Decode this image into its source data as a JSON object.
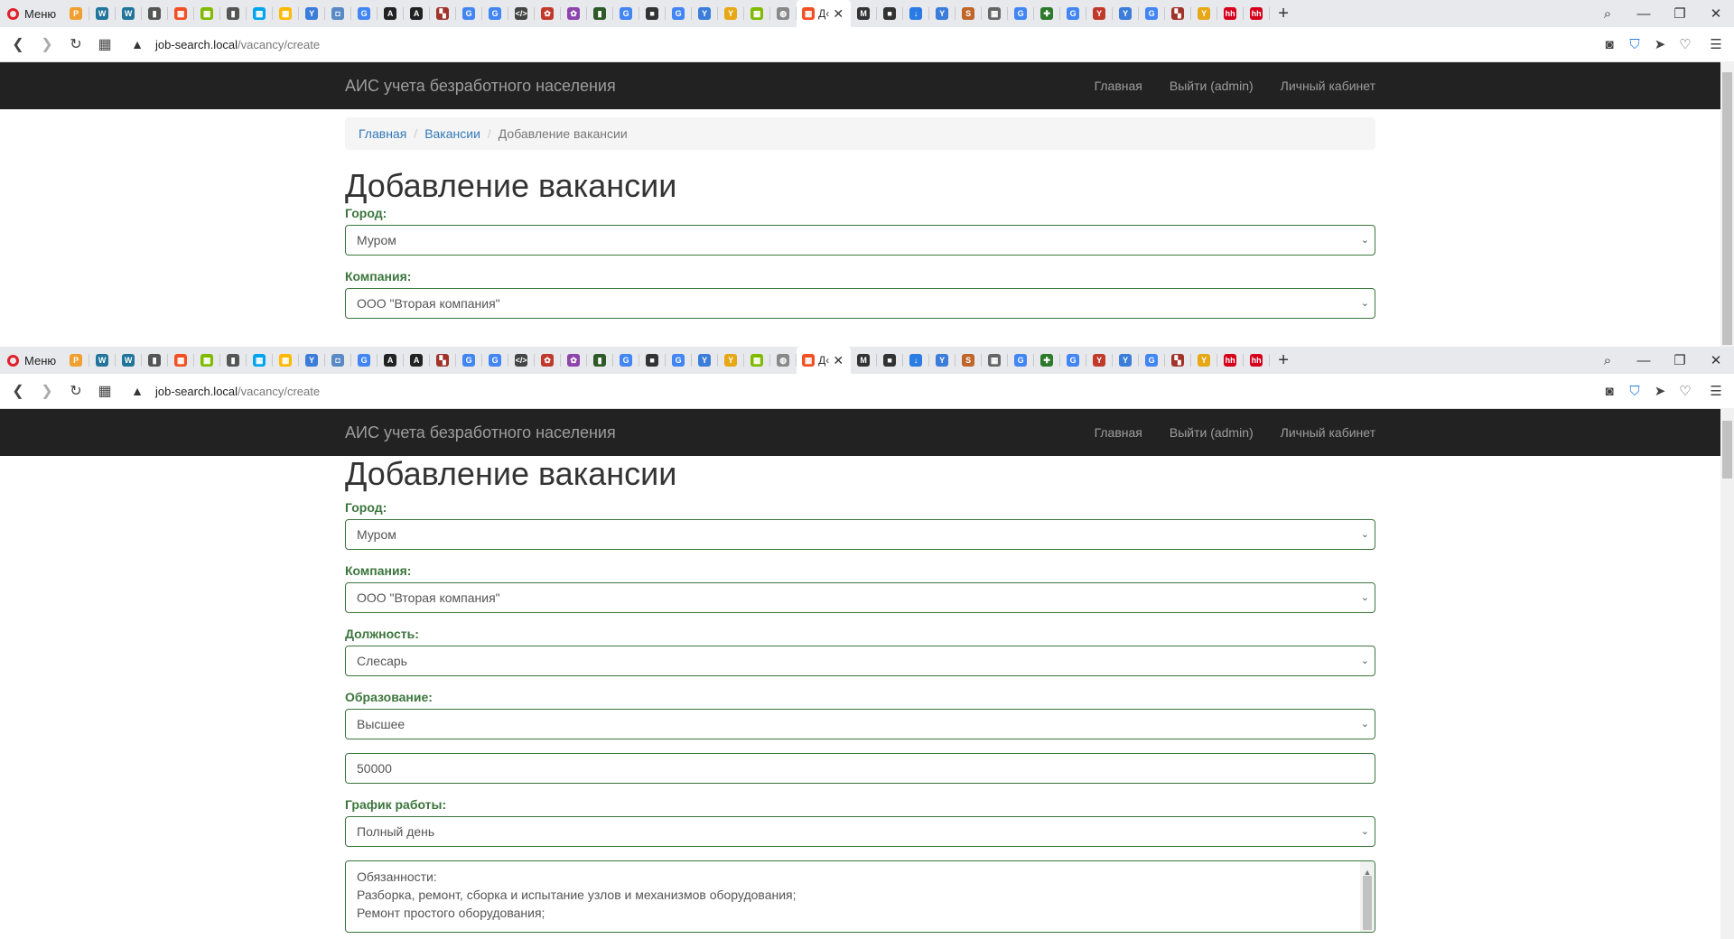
{
  "browser": {
    "menu_label": "Меню",
    "active_tab_label": "Д‹",
    "url_host": "job-search.local",
    "url_path": "/vacancy/create",
    "tab_favicons": [
      {
        "icon": "pma-icon",
        "color": "#f0a030",
        "glyph": "P"
      },
      {
        "icon": "wordpress-icon",
        "color": "#21759b",
        "glyph": "W"
      },
      {
        "icon": "wordpress-icon",
        "color": "#21759b",
        "glyph": "W"
      },
      {
        "icon": "document-icon",
        "color": "#555555",
        "glyph": "▮"
      },
      {
        "icon": "windows-icon",
        "color": "#f25022",
        "glyph": "▦"
      },
      {
        "icon": "windows-icon",
        "color": "#7fba00",
        "glyph": "▦"
      },
      {
        "icon": "document-icon",
        "color": "#555555",
        "glyph": "▮"
      },
      {
        "icon": "windows-icon",
        "color": "#00a4ef",
        "glyph": "▦"
      },
      {
        "icon": "windows-icon",
        "color": "#ffb900",
        "glyph": "▦"
      },
      {
        "icon": "yandex-icon",
        "color": "#3b7dd8",
        "glyph": "Y"
      },
      {
        "icon": "box-icon",
        "color": "#5a8ac6",
        "glyph": "◘"
      },
      {
        "icon": "google-icon",
        "color": "#4285f4",
        "glyph": "G"
      },
      {
        "icon": "font-icon",
        "color": "#222222",
        "glyph": "A"
      },
      {
        "icon": "font-icon",
        "color": "#222222",
        "glyph": "A"
      },
      {
        "icon": "grid-icon",
        "color": "#a0342a",
        "glyph": "▚"
      },
      {
        "icon": "google-icon",
        "color": "#4285f4",
        "glyph": "G"
      },
      {
        "icon": "google-icon",
        "color": "#4285f4",
        "glyph": "G"
      },
      {
        "icon": "code-icon",
        "color": "#444444",
        "glyph": "</>"
      },
      {
        "icon": "flower-icon",
        "color": "#c0392b",
        "glyph": "✿"
      },
      {
        "icon": "flower-icon",
        "color": "#8e44ad",
        "glyph": "✿"
      },
      {
        "icon": "bottle-icon",
        "color": "#2d5a27",
        "glyph": "▮"
      },
      {
        "icon": "google-icon",
        "color": "#4285f4",
        "glyph": "G"
      },
      {
        "icon": "square-icon",
        "color": "#333333",
        "glyph": "■"
      },
      {
        "icon": "google-icon",
        "color": "#4285f4",
        "glyph": "G"
      },
      {
        "icon": "yandex-icon",
        "color": "#3b7dd8",
        "glyph": "Y"
      },
      {
        "icon": "yandex-icon",
        "color": "#e6a817",
        "glyph": "Y"
      },
      {
        "icon": "windows-icon",
        "color": "#7fba00",
        "glyph": "▦"
      },
      {
        "icon": "globe-icon",
        "color": "#888888",
        "glyph": "◍"
      }
    ],
    "tab_favicons_right": [
      {
        "icon": "mail-icon",
        "color": "#333333",
        "glyph": "M"
      },
      {
        "icon": "square-icon",
        "color": "#333333",
        "glyph": "■"
      },
      {
        "icon": "download-icon",
        "color": "#2a7be4",
        "glyph": "↓"
      },
      {
        "icon": "yandex-icon",
        "color": "#3b7dd8",
        "glyph": "Y"
      },
      {
        "icon": "s-icon",
        "color": "#c0662b",
        "glyph": "S"
      },
      {
        "icon": "grid-icon",
        "color": "#666666",
        "glyph": "▦"
      },
      {
        "icon": "google-icon",
        "color": "#4285f4",
        "glyph": "G"
      },
      {
        "icon": "puzzle-icon",
        "color": "#2d7a2d",
        "glyph": "✚"
      },
      {
        "icon": "google-icon",
        "color": "#4285f4",
        "glyph": "G"
      },
      {
        "icon": "yandex-icon",
        "color": "#c0392b",
        "glyph": "Y"
      },
      {
        "icon": "yandex-icon",
        "color": "#3b7dd8",
        "glyph": "Y"
      },
      {
        "icon": "google-icon",
        "color": "#4285f4",
        "glyph": "G"
      },
      {
        "icon": "grid-icon",
        "color": "#a0342a",
        "glyph": "▚"
      },
      {
        "icon": "yandex-icon",
        "color": "#e6a817",
        "glyph": "Y"
      },
      {
        "icon": "hh-icon",
        "color": "#d6001c",
        "glyph": "hh"
      },
      {
        "icon": "hh-icon",
        "color": "#d6001c",
        "glyph": "hh"
      }
    ]
  },
  "site": {
    "brand": "АИС учета безработного населения",
    "nav": [
      "Главная",
      "Выйти (admin)",
      "Личный кабинет"
    ]
  },
  "breadcrumb": {
    "home": "Главная",
    "vacancies": "Вакансии",
    "current": "Добавление вакансии"
  },
  "page_title": "Добавление вакансии",
  "form": {
    "city_label": "Город:",
    "city_value": "Муром",
    "company_label": "Компания:",
    "company_value": "ООО \"Вторая компания\"",
    "position_label": "Должность:",
    "position_value": "Слесарь",
    "education_label": "Образование:",
    "education_value": "Высшее",
    "salary_value": "50000",
    "schedule_label": "График работы:",
    "schedule_value": "Полный день",
    "description_lines": [
      "Обязанности:",
      "Разборка, ремонт, сборка и испытание узлов и механизмов оборудования;",
      "Ремонт простого оборудования;"
    ]
  }
}
